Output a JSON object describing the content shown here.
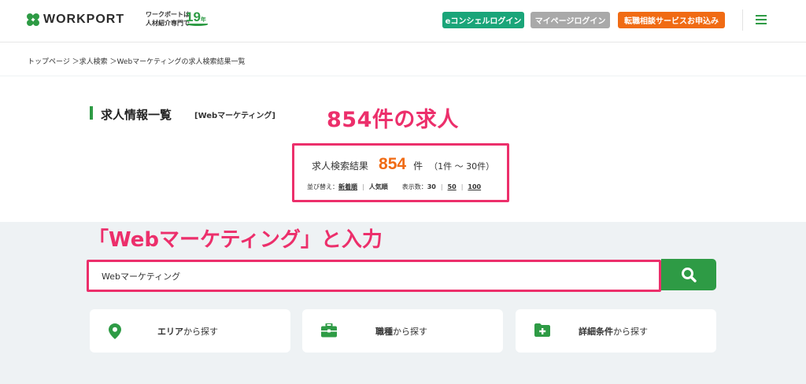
{
  "header": {
    "logo_text": "WORKPORT",
    "tagline_line1": "ワークポートは",
    "tagline_line2": "人材紹介専門で",
    "years": "19",
    "years_suffix": "年",
    "buttons": {
      "econcierge": "eコンシェルログイン",
      "mypage": "マイページログイン",
      "apply": "転職相談サービスお申込み"
    },
    "colors": {
      "brand_green": "#2e9b45",
      "econ": "#1aa579",
      "mypage": "#a9a9a9",
      "apply": "#f06b14"
    }
  },
  "breadcrumb": "トップページ ＞求人検索 ＞Webマーケティングの求人検索結果一覧",
  "main": {
    "title": "求人情報一覧",
    "keyword_tag": "[Webマーケティング]",
    "annotation_count": "854件の求人",
    "result": {
      "label": "求人検索結果",
      "count": "854",
      "unit": "件",
      "range": "（1件 〜 30件）"
    },
    "sort": {
      "label": "並び替え：",
      "newest": "新着順",
      "popular": "人気順",
      "per_page_label": "表示数：",
      "per_page_options": [
        "30",
        "50",
        "100"
      ]
    }
  },
  "search": {
    "annotation": "「Webマーケティング」と入力",
    "value": "Webマーケティング",
    "button_icon": "search-icon"
  },
  "cards": [
    {
      "bold": "エリア",
      "rest": "から探す",
      "icon": "map-pin-icon"
    },
    {
      "bold": "職種",
      "rest": "から探す",
      "icon": "briefcase-icon"
    },
    {
      "bold": "詳細条件",
      "rest": "から探す",
      "icon": "folder-plus-icon"
    }
  ],
  "annotation_color": "#ec2f6b"
}
